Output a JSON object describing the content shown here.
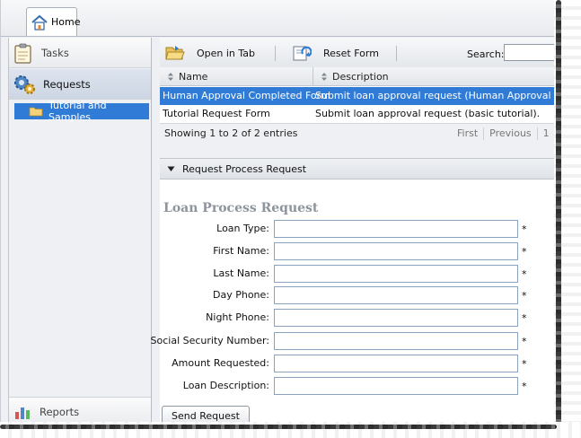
{
  "top_tab": {
    "label": "Home"
  },
  "sidebar": {
    "tasks_label": "Tasks",
    "requests_label": "Requests",
    "tree_item_label": "Tutorial and Samples",
    "reports_label": "Reports"
  },
  "toolbar": {
    "open_label": "Open in Tab",
    "reset_label": "Reset Form",
    "search_label": "Search:",
    "search_value": ""
  },
  "grid": {
    "columns": [
      "Name",
      "Description"
    ],
    "rows": [
      {
        "name": "Human Approval Completed Form",
        "description": "Submit loan approval request (Human Approval Complete"
      },
      {
        "name": "Tutorial Request Form",
        "description": "Submit loan approval request (basic tutorial)."
      }
    ],
    "footer": "Showing 1 to 2 of 2 entries",
    "pager": {
      "first": "First",
      "previous": "Previous",
      "page": "1"
    }
  },
  "panel": {
    "header": "Request Process Request",
    "form_title": "Loan Process Request",
    "fields": [
      {
        "label": "Loan Type:",
        "value": ""
      },
      {
        "label": "First Name:",
        "value": ""
      },
      {
        "label": "Last Name:",
        "value": ""
      },
      {
        "label": "Day Phone:",
        "value": ""
      },
      {
        "label": "Night Phone:",
        "value": ""
      },
      {
        "label": "Social Security Number:",
        "value": ""
      },
      {
        "label": "Amount Requested:",
        "value": ""
      },
      {
        "label": "Loan Description:",
        "value": ""
      }
    ],
    "required_mark": "*",
    "submit_label": "Send Request"
  },
  "colors": {
    "selection": "#2f7bd6",
    "form_title": "#8d949c",
    "panel_bg": "#eef0f3"
  }
}
